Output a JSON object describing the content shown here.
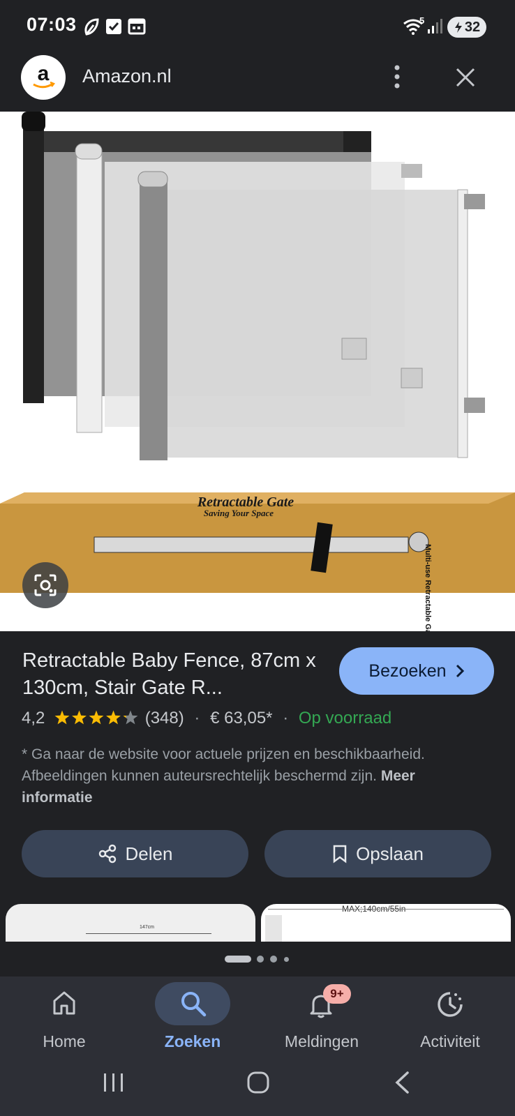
{
  "status_bar": {
    "time": "07:03",
    "icons": [
      "leaf-icon",
      "checkbox-icon",
      "calendar-icon"
    ],
    "network_label": "5",
    "battery": "32"
  },
  "header": {
    "site_name": "Amazon.nl",
    "logo_letter": "a",
    "menu_icon": "more-vert-icon",
    "close_icon": "close-icon"
  },
  "image": {
    "box_title": "Retractable Gate",
    "box_subtitle": "Saving Your Space",
    "box_side_text": "Multi-use Retractable Gate",
    "lens_icon": "lens-icon"
  },
  "product": {
    "title": "Retractable Baby Fence, 87cm x 130cm, Stair Gate R...",
    "visit_label": "Bezoeken",
    "rating": "4,2",
    "stars_filled": 4.2,
    "review_count": "(348)",
    "price": "€ 63,05*",
    "stock": "Op voorraad",
    "stock_color": "#34a853",
    "disclaimer": "* Ga naar de website voor actuele prijzen en beschikbaarheid. Afbeeldingen kunnen auteursrechtelijk beschermd zijn.",
    "more_info": "Meer informatie"
  },
  "actions": {
    "share_label": "Delen",
    "save_label": "Opslaan"
  },
  "thumbnails": {
    "left_caption": "147cm",
    "right_caption": "MAX;140cm/55in"
  },
  "bottom_nav": {
    "items": [
      {
        "label": "Home",
        "icon": "home-icon"
      },
      {
        "label": "Zoeken",
        "icon": "search-icon"
      },
      {
        "label": "Meldingen",
        "icon": "bell-icon",
        "badge": "9+"
      },
      {
        "label": "Activiteit",
        "icon": "activity-icon"
      }
    ],
    "active_color": "#8ab4f8"
  }
}
